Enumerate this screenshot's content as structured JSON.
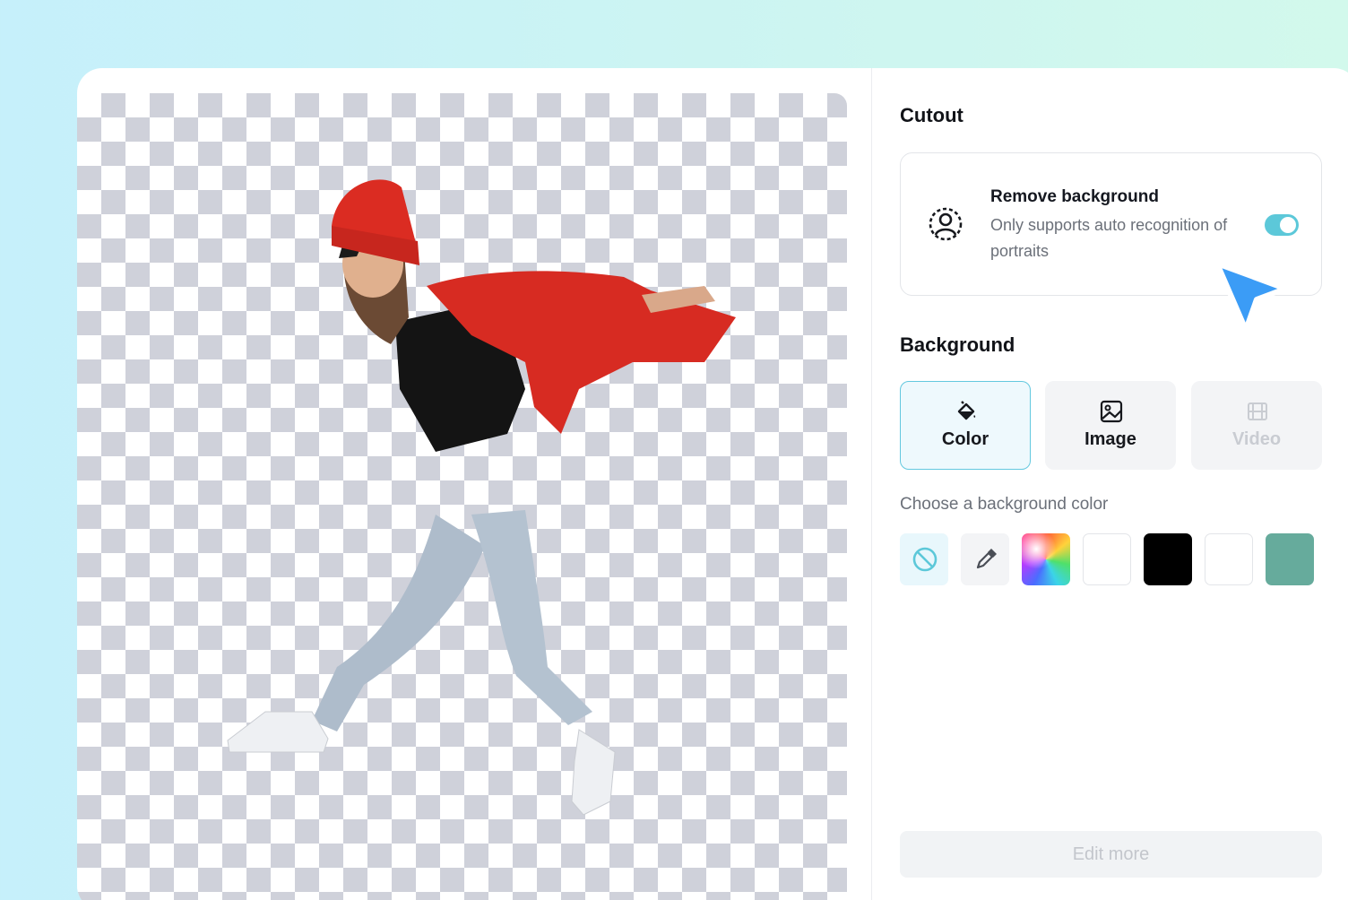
{
  "cutout": {
    "title": "Cutout",
    "remove_background": {
      "title": "Remove background",
      "description": "Only supports auto recognition of portraits",
      "enabled": true,
      "icon": "person-scan-icon"
    }
  },
  "background": {
    "title": "Background",
    "tabs": [
      {
        "label": "Color",
        "icon": "paint-bucket-icon",
        "state": "active"
      },
      {
        "label": "Image",
        "icon": "image-icon",
        "state": "normal"
      },
      {
        "label": "Video",
        "icon": "film-icon",
        "state": "disabled"
      }
    ],
    "hint": "Choose a background color",
    "swatches": [
      {
        "kind": "none",
        "icon": "no-color-icon"
      },
      {
        "kind": "picker",
        "icon": "eyedropper-icon"
      },
      {
        "kind": "gradient"
      },
      {
        "kind": "color",
        "color": "#ffffff"
      },
      {
        "kind": "color",
        "color": "#000000"
      },
      {
        "kind": "color",
        "color": "#ffffff"
      },
      {
        "kind": "color",
        "color": "#66ab9c"
      }
    ]
  },
  "footer": {
    "edit_more_label": "Edit more"
  },
  "colors": {
    "accent": "#5cc8d9",
    "cursor": "#3b9cf6"
  }
}
